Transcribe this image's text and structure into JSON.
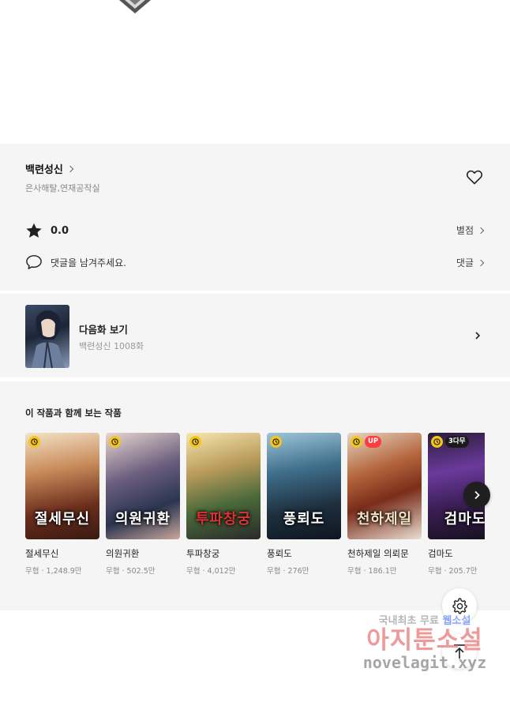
{
  "header": {
    "emblem_icon": "shield-emblem-icon"
  },
  "series": {
    "title": "백련성신",
    "authors": "은사해탈,연재공작실",
    "rating": "0.0",
    "rating_link": "별점",
    "comment_placeholder": "댓글을 남겨주세요.",
    "comment_link": "댓글"
  },
  "next_episode": {
    "label": "다음화 보기",
    "subtitle": "백련성신 1008화"
  },
  "recommendations": {
    "title": "이 작품과 함께 보는 작품",
    "items": [
      {
        "name": "절세무신",
        "meta": "무협 · 1,248.9만",
        "cover_text": "절세무신",
        "badge": ""
      },
      {
        "name": "의원귀환",
        "meta": "무협 · 502.5만",
        "cover_text": "의원귀환",
        "badge": ""
      },
      {
        "name": "투파창궁",
        "meta": "무협 · 4,012만",
        "cover_text": "투파창궁",
        "badge": ""
      },
      {
        "name": "풍뢰도",
        "meta": "무협 · 276만",
        "cover_text": "풍뢰도",
        "badge": ""
      },
      {
        "name": "천하제일 의뢰문",
        "meta": "무협 · 186.1만",
        "cover_text": "천하제일",
        "badge": "UP"
      },
      {
        "name": "검마도",
        "meta": "무협 · 205.7만",
        "cover_text": "검마도",
        "badge": "3다무"
      }
    ]
  },
  "watermark": {
    "line1_a": "국내최초 무료",
    "line1_b": "웹소설",
    "line2": "아지툰소설",
    "line3": "novelagit.xyz"
  },
  "colors": {
    "badge_clock": "#f5c518",
    "badge_up": "#ff3b3b",
    "panel_bg": "#f5f5f5"
  }
}
